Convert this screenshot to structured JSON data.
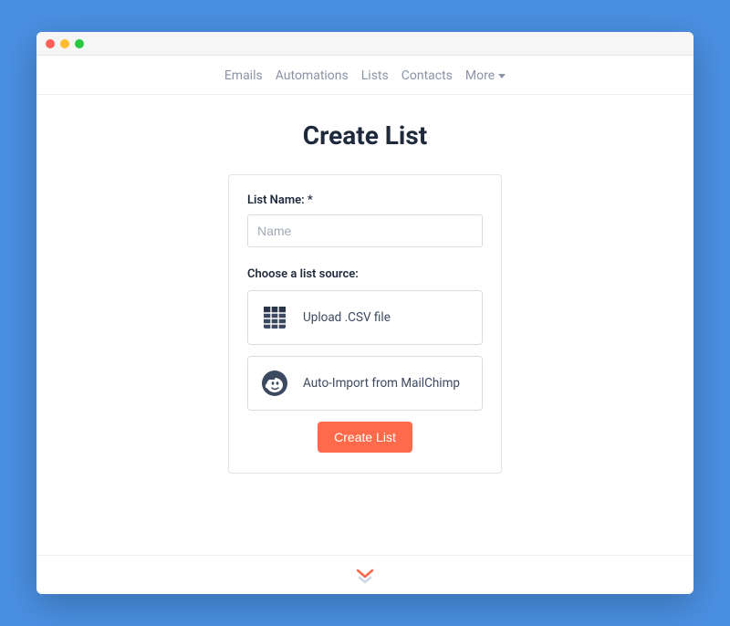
{
  "nav": {
    "items": [
      "Emails",
      "Automations",
      "Lists",
      "Contacts",
      "More"
    ]
  },
  "page": {
    "title": "Create List"
  },
  "form": {
    "name_label": "List Name: *",
    "name_placeholder": "Name",
    "source_label": "Choose a list source:",
    "sources": [
      {
        "icon": "spreadsheet-icon",
        "label": "Upload .CSV file"
      },
      {
        "icon": "mailchimp-icon",
        "label": "Auto-Import from MailChimp"
      }
    ],
    "submit_label": "Create List"
  },
  "colors": {
    "background": "#4a90e2",
    "accent": "#ff6b4a",
    "text_dark": "#1e2a3b",
    "text_muted": "#8a94a6",
    "icon_fill": "#3b4a60"
  }
}
